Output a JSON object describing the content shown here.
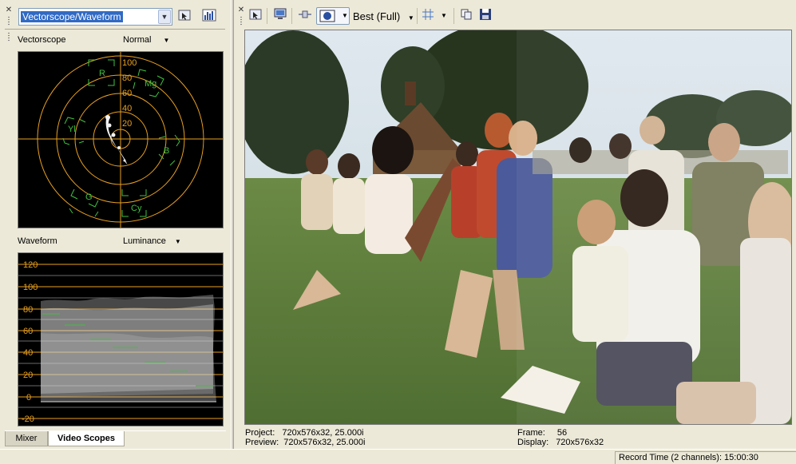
{
  "scope_selector": {
    "value": "Vectorscope/Waveform"
  },
  "vectorscope": {
    "label": "Vectorscope",
    "mode": "Normal",
    "ring_labels": [
      "100",
      "80",
      "60",
      "40",
      "20"
    ],
    "targets": [
      "R",
      "Mg",
      "B",
      "Cy",
      "G",
      "Yl"
    ]
  },
  "waveform": {
    "label": "Waveform",
    "mode": "Luminance",
    "scale_labels": [
      "120",
      "100",
      "80",
      "60",
      "40",
      "20",
      "0",
      "-20"
    ]
  },
  "tabs": [
    {
      "label": "Mixer",
      "active": false
    },
    {
      "label": "Video Scopes",
      "active": true
    }
  ],
  "preview_toolbar": {
    "quality": "Best (Full)"
  },
  "info": {
    "project_label": "Project:",
    "project_value": "720x576x32, 25.000i",
    "preview_label": "Preview:",
    "preview_value": "720x576x32, 25.000i",
    "frame_label": "Frame:",
    "frame_value": "56",
    "display_label": "Display:",
    "display_value": "720x576x32"
  },
  "status": {
    "record_time": "Record Time (2 channels): 15:00:30"
  },
  "colors": {
    "scope_orange": "#e8a020",
    "scope_green": "#40c040",
    "selection_blue": "#316ac5"
  }
}
